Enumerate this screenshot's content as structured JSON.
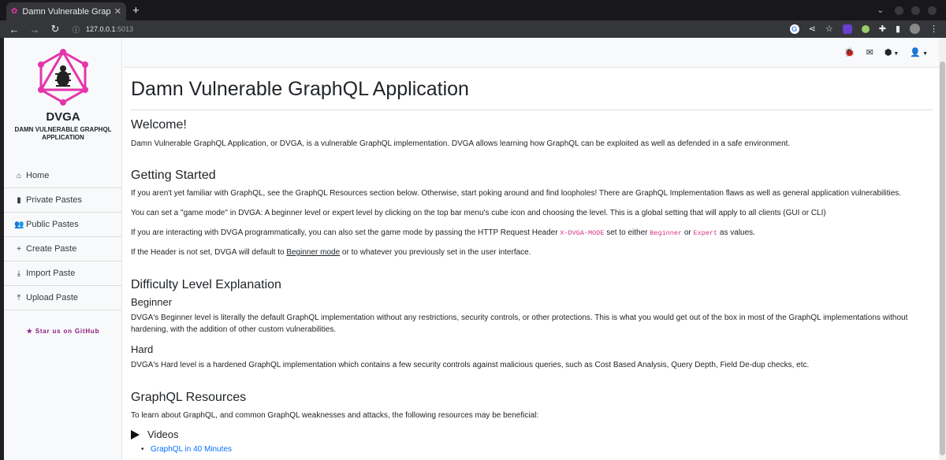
{
  "browser": {
    "tab_title": "Damn Vulnerable GraphQ",
    "tab_close": "✕",
    "new_tab": "+",
    "url_host": "127.0.0.1",
    "url_port": ":5013"
  },
  "sidebar": {
    "brand": "DVGA",
    "brand_subtitle": "DAMN VULNERABLE GRAPHQL APPLICATION",
    "items": [
      {
        "label": "Home",
        "icon": "home-icon"
      },
      {
        "label": "Private Pastes",
        "icon": "clipboard-icon"
      },
      {
        "label": "Public Pastes",
        "icon": "users-icon"
      },
      {
        "label": "Create Paste",
        "icon": "plus-icon"
      },
      {
        "label": "Import Paste",
        "icon": "download-icon"
      },
      {
        "label": "Upload Paste",
        "icon": "upload-icon"
      }
    ],
    "star_link": "Star us on GitHub",
    "accent_color": "#e535ab"
  },
  "main": {
    "title": "Damn Vulnerable GraphQL Application",
    "welcome_heading": "Welcome!",
    "welcome_text": "Damn Vulnerable GraphQL Application, or DVGA, is a vulnerable GraphQL implementation. DVGA allows learning how GraphQL can be exploited as well as defended in a safe environment.",
    "getting_started_heading": "Getting Started",
    "gs_p1": "If you aren't yet familiar with GraphQL, see the GraphQL Resources section below. Otherwise, start poking around and find loopholes! There are GraphQL Implementation flaws as well as general application vulnerabilities.",
    "gs_p2": "You can set a \"game mode\" in DVGA: A beginner level or expert level by clicking on the top bar menu's cube icon and choosing the level. This is a global setting that will apply to all clients (GUI or CLI)",
    "gs_p3_a": "If you are interacting with DVGA programmatically, you can also set the game mode by passing the HTTP Request Header ",
    "gs_p3_code1": "X-DVGA-MODE",
    "gs_p3_b": " set to either ",
    "gs_p3_code2": "Beginner",
    "gs_p3_c": " or ",
    "gs_p3_code3": "Expert",
    "gs_p3_d": " as values.",
    "gs_p4_a": "If the Header is not set, DVGA will default to ",
    "gs_p4_link": "Beginner mode",
    "gs_p4_b": " or to whatever you previously set in the user interface.",
    "difficulty_heading": "Difficulty Level Explanation",
    "beginner_heading": "Beginner",
    "beginner_text": "DVGA's Beginner level is literally the default GraphQL implementation without any restrictions, security controls, or other protections. This is what you would get out of the box in most of the GraphQL implementations without hardening, with the addition of other custom vulnerabilities.",
    "hard_heading": "Hard",
    "hard_text": "DVGA's Hard level is a hardened GraphQL implementation which contains a few security controls against malicious queries, such as Cost Based Analysis, Query Depth, Field De-dup checks, etc.",
    "resources_heading": "GraphQL Resources",
    "resources_text": "To learn about GraphQL, and common GraphQL weaknesses and attacks, the following resources may be beneficial:",
    "videos_label": "Videos",
    "video_link": "GraphQL in 40 Minutes"
  }
}
